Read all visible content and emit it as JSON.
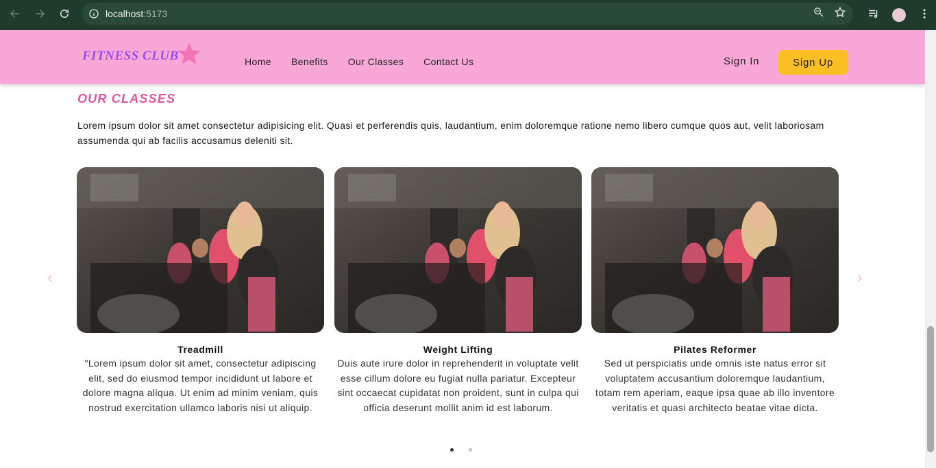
{
  "browser": {
    "url_host": "localhost",
    "url_port": ":5173",
    "icons": [
      "back-icon",
      "forward-icon",
      "reload-icon",
      "site-info-icon",
      "zoom-icon",
      "bookmark-star-icon",
      "media-control-icon",
      "profile-avatar",
      "more-menu-icon"
    ]
  },
  "navbar": {
    "logo_text": "FITNESS CLUB",
    "menu": [
      "Home",
      "Benefits",
      "Our Classes",
      "Contact Us"
    ],
    "sign_in": "Sign In",
    "sign_up": "Sign Up",
    "colors": {
      "bar": "#f8a7d6",
      "logo": "#9b4cf0",
      "star": "#f472b6",
      "signup_button": "#fbbf24"
    }
  },
  "section": {
    "title": "OUR CLASSES",
    "intro": "Lorem ipsum dolor sit amet consectetur adipisicing elit. Quasi et perferendis quis, laudantium, enim doloremque ratione nemo libero cumque quos aut, velit laboriosam assumenda qui ab facilis accusamus deleniti sit.",
    "title_color": "#e0559b"
  },
  "carousel": {
    "prev_arrow": "‹",
    "next_arrow": "›",
    "cards": [
      {
        "title": "Treadmill",
        "description": "\"Lorem ipsum dolor sit amet, consectetur adipiscing elit, sed do eiusmod tempor incididunt ut labore et dolore magna aliqua. Ut enim ad minim veniam, quis nostrud exercitation ullamco laboris nisi ut aliquip."
      },
      {
        "title": "Weight Lifting",
        "description": "Duis aute irure dolor in reprehenderit in voluptate velit esse cillum dolore eu fugiat nulla pariatur. Excepteur sint occaecat cupidatat non proident, sunt in culpa qui officia deserunt mollit anim id est laborum."
      },
      {
        "title": "Pilates Reformer",
        "description": "Sed ut perspiciatis unde omnis iste natus error sit voluptatem accusantium doloremque laudantium, totam rem aperiam, eaque ipsa quae ab illo inventore veritatis et quasi architecto beatae vitae dicta."
      }
    ],
    "page_count": 2,
    "active_page": 1
  }
}
